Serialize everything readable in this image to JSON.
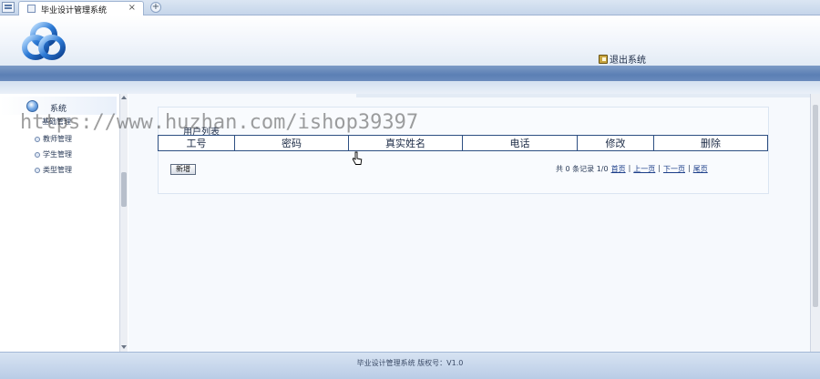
{
  "browser": {
    "tab_title": "毕业设计管理系统",
    "tab_close": "×",
    "new_tab": "+"
  },
  "header": {
    "logout_label": "退出系统"
  },
  "sidebar": {
    "section_label": "系统",
    "group_label": "基础管理",
    "items": [
      {
        "label": "教师管理"
      },
      {
        "label": "学生管理"
      },
      {
        "label": "类型管理"
      }
    ]
  },
  "main": {
    "panel_title": "用户列表",
    "table": {
      "columns": [
        "工号",
        "密码",
        "真实姓名",
        "电话",
        "修改",
        "删除"
      ]
    },
    "add_button": "新增",
    "pager": {
      "summary": "共 0 条记录 1/0",
      "first": "首页",
      "sep1": "|",
      "prev": "上一页",
      "sep2": "|",
      "next": "下一页",
      "sep3": "|",
      "last": "尾页"
    }
  },
  "footer": {
    "text": "毕业设计管理系统  版权号：V1.0"
  },
  "watermark": "https://www.huzhan.com/ishop39397",
  "colors": {
    "accent": "#5b7fb4",
    "grid_border": "#2d4f82",
    "link": "#1d3f8a"
  }
}
